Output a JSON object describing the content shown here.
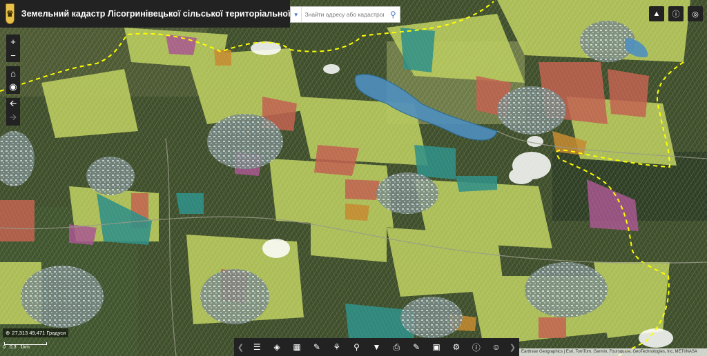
{
  "header": {
    "title": "Земельний кадастр Лісогринівецької сільської територіальної громади"
  },
  "search": {
    "placeholder": "Знайти адресу або кадастровий н"
  },
  "map": {
    "coords_readout": "27,313 49,471 Градуси",
    "scale_labels": [
      "0",
      "0,3",
      "1km"
    ],
    "attribution": "Earthstar Geographics | Esri, TomTom, Garmin, Foursquare, GeoTechnologies, Inc, METI/NASA",
    "colors": {
      "field_green": "#b5c75a",
      "field_red": "#c2614f",
      "field_teal": "#2f8f86",
      "field_purple": "#a8568f",
      "field_orange": "#c5892f",
      "water": "#4f8fbf",
      "boundary": "#ffff00"
    }
  },
  "tools": {
    "top_right": [
      "basemap-icon",
      "info-icon",
      "compass-icon"
    ],
    "nav": [
      "zoom-in-icon",
      "zoom-out-icon",
      "home-icon",
      "locate-icon",
      "back-icon",
      "forward-icon"
    ],
    "toolbar": [
      "layer-list-icon",
      "layers-icon",
      "basemap-gallery-icon",
      "measure-icon",
      "draw-icon",
      "query-icon",
      "filter-icon",
      "print-icon",
      "edit-icon",
      "swipe-icon",
      "analysis-icon",
      "about-icon",
      "smile-icon"
    ]
  }
}
